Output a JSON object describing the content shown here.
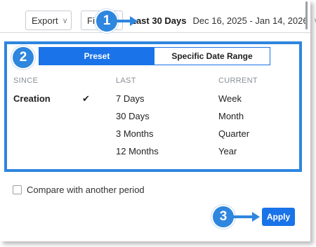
{
  "toolbar": {
    "export_label": "Export",
    "filter_label": "Filt",
    "chevron_glyph": "∨",
    "period_label": "Last 30 Days",
    "date_range": "Dec 16, 2025 - Jan 14, 2026"
  },
  "tabs": {
    "preset": "Preset",
    "specific": "Specific Date Range"
  },
  "columns": {
    "since": {
      "header": "SINCE",
      "items": [
        "Creation"
      ],
      "selected": "Creation"
    },
    "last": {
      "header": "LAST",
      "items": [
        "7 Days",
        "30 Days",
        "3 Months",
        "12 Months"
      ]
    },
    "current": {
      "header": "CURRENT",
      "items": [
        "Week",
        "Month",
        "Quarter",
        "Year"
      ]
    }
  },
  "checkmark_glyph": "✔",
  "compare": {
    "label": "Compare with another period",
    "checked": false
  },
  "apply_label": "Apply",
  "callouts": {
    "one": "1",
    "two": "2",
    "three": "3"
  },
  "colors": {
    "accent": "#1a73e8",
    "callout": "#2e86de",
    "muted_text": "#8a8f95"
  }
}
